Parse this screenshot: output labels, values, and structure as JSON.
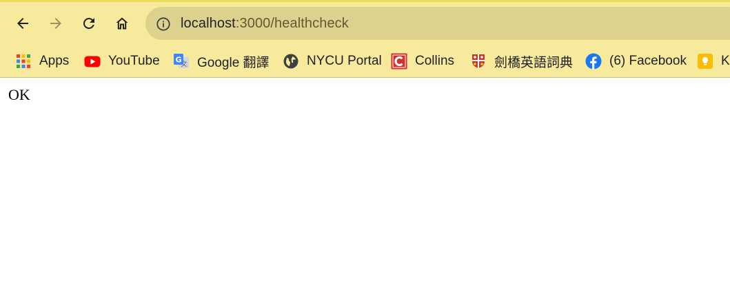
{
  "browser": {
    "url_host": "localhost",
    "url_path": ":3000/healthcheck"
  },
  "bookmarks": [
    {
      "label": "Apps",
      "icon": "apps-grid-icon"
    },
    {
      "label": "YouTube",
      "icon": "youtube-icon"
    },
    {
      "label": "Google 翻譯",
      "icon": "google-translate-icon"
    },
    {
      "label": "NYCU Portal",
      "icon": "globe-icon"
    },
    {
      "label": "Collins",
      "icon": "collins-icon"
    },
    {
      "label": "劍橋英語詞典",
      "icon": "cambridge-icon"
    },
    {
      "label": "(6) Facebook",
      "icon": "facebook-icon"
    },
    {
      "label": "K",
      "icon": "keep-icon"
    }
  ],
  "page": {
    "body_text": "OK"
  }
}
